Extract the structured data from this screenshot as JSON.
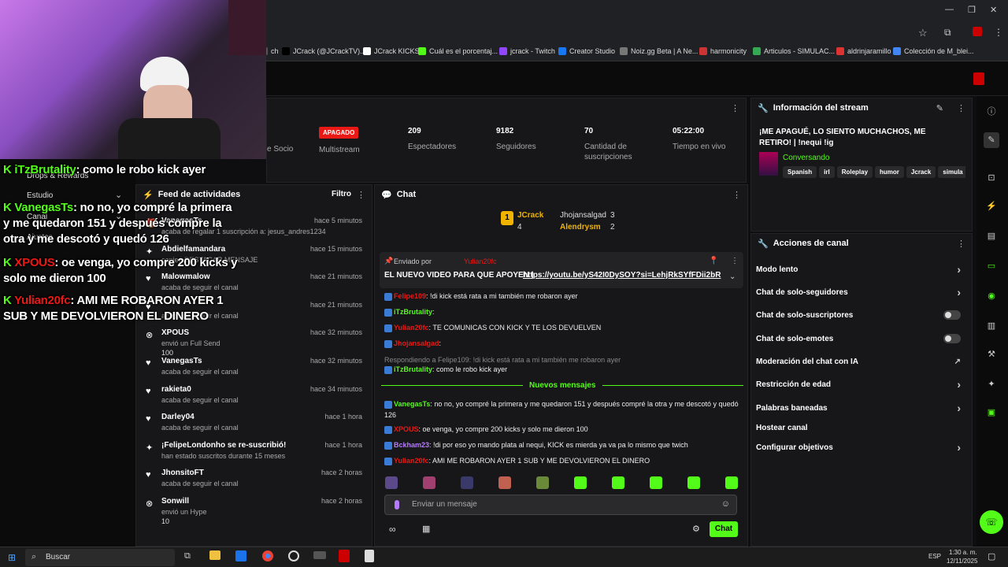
{
  "bookmarks": [
    {
      "label": "ch",
      "color": "#555"
    },
    {
      "label": "JCrack (@JCrackTV)...",
      "color": "#000"
    },
    {
      "label": "JCrack KICKS",
      "color": "#fff"
    },
    {
      "label": "Cuál es el porcentaj...",
      "color": "#53fc18"
    },
    {
      "label": "jcrack - Twitch",
      "color": "#9146ff"
    },
    {
      "label": "Creator Studio",
      "color": "#1877f2"
    },
    {
      "label": "Noiz.gg Beta | A Ne...",
      "color": "#777"
    },
    {
      "label": "harmonicity",
      "color": "#c33"
    },
    {
      "label": "Articulos - SIMULAC...",
      "color": "#34a853"
    },
    {
      "label": "aldrinjaramillo",
      "color": "#d33"
    },
    {
      "label": "Colección de M_blei...",
      "color": "#4285f4"
    }
  ],
  "stats": {
    "socio_label": "e Socio",
    "multistream_badge": "APAGADO",
    "multistream_label": "Multistream",
    "viewers_value": "209",
    "viewers_label": "Espectadores",
    "followers_value": "9182",
    "followers_label": "Seguidores",
    "subs_value": "70",
    "subs_label": "Cantidad de suscripciones",
    "live_value": "05:22:00",
    "live_label": "Tiempo en vivo"
  },
  "stream_info": {
    "header": "Información del stream",
    "title": "¡ME APAGUÉ, LO SIENTO MUCHACHOS, ME RETIRO! | !nequi !ig",
    "category": "Conversando",
    "tags": [
      "Spanish",
      "irl",
      "Roleplay",
      "humor",
      "Jcrack",
      "simula"
    ]
  },
  "left_nav": {
    "drops": "Drops & Rewards",
    "studio": "Estudio",
    "canal": "Canal",
    "ajustes": "Ajustes"
  },
  "feed": {
    "header": "Feed de actividades",
    "filter": "Filtro",
    "items": [
      {
        "name": "VanegasTs",
        "sub": "acaba de regalar 1 suscripción a: jesus_andres1234",
        "time": "hace 5 minutos",
        "icon": "gift-icon"
      },
      {
        "name": "Abdielfamandara",
        "sub": "canjeó DESTACAR MENSAJE",
        "time": "hace 15 minutos",
        "icon": "star-icon"
      },
      {
        "name": "Malowmalow",
        "sub": "acaba de seguir el canal",
        "time": "hace 21 minutos",
        "icon": "heart-icon"
      },
      {
        "name": "",
        "sub": "acaba de seguir el canal",
        "time": "hace 21 minutos",
        "icon": "heart-icon"
      },
      {
        "name": "XPOUS",
        "sub": "envió un Full Send",
        "extra": "100",
        "time": "hace 32 minutos",
        "icon": "kick-icon"
      },
      {
        "name": "VanegasTs",
        "sub": "acaba de seguir el canal",
        "time": "hace 32 minutos",
        "icon": "heart-icon"
      },
      {
        "name": "rakieta0",
        "sub": "acaba de seguir el canal",
        "time": "hace 34 minutos",
        "icon": "heart-icon"
      },
      {
        "name": "Darley04",
        "sub": "acaba de seguir el canal",
        "time": "hace 1 hora",
        "icon": "heart-icon"
      },
      {
        "name": "¡FelipeLondonho se re-suscribió!",
        "sub": "han estado suscritos durante 15 meses",
        "time": "hace 1 hora",
        "icon": "star-icon"
      },
      {
        "name": "JhonsitoFT",
        "sub": "acaba de seguir el canal",
        "time": "hace 2 horas",
        "icon": "heart-icon"
      },
      {
        "name": "Sonwill",
        "sub": "envió un Hype",
        "extra": "10",
        "time": "hace 2 horas",
        "icon": "kick-icon"
      }
    ]
  },
  "chat": {
    "header": "Chat",
    "top_users": [
      {
        "name": "JCrack",
        "count": "4"
      },
      {
        "name": "Jhojansalgad",
        "count": "3"
      },
      {
        "name": "Alendrysm",
        "count": "2"
      }
    ],
    "pinned_by_label": "Enviado por",
    "pinned_by_user": "Yulian20fc",
    "pinned_text": "EL NUEVO VIDEO PARA QUE APOYEN |",
    "pinned_link": "https://youtu.be/yS42I0DySOY?si=LehjRkSYfFDii2bR",
    "messages": [
      {
        "user": "Felipe109",
        "color": "#e91916",
        "text": "!di kick está rata a mi también me robaron ayer"
      },
      {
        "user": "iTzBrutality",
        "color": "#53fc18",
        "text": ""
      },
      {
        "user": "Yulian20fc",
        "color": "#e91916",
        "text": "TE COMUNICAS CON KICK Y TE LOS DEVUELVEN"
      },
      {
        "user": "Jhojansalgad",
        "color": "#e91916",
        "text": ""
      },
      {
        "reply": "Respondiendo a Felipe109: !di kick está rata a mi también me robaron ayer"
      },
      {
        "user": "iTzBrutality",
        "color": "#53fc18",
        "text": "como le robo kick ayer"
      }
    ],
    "new_messages_label": "Nuevos mensajes",
    "new_messages": [
      {
        "user": "VanegasTs",
        "color": "#53fc18",
        "text": "no no, yo compré la primera y me quedaron 151 y después compré la otra y me descotó y quedó 126"
      },
      {
        "user": "XPOUS",
        "color": "#e91916",
        "text": "oe venga, yo compre 200 kicks y solo me dieron 100"
      },
      {
        "user": "Bckham23",
        "color": "#b57bff",
        "text": "!di por eso yo mando plata al nequi, KICK es mierda ya va pa lo mismo que twich"
      },
      {
        "user": "Yulian20fc",
        "color": "#e91916",
        "text": "AMI ME ROBARON AYER 1 SUB Y ME DEVOLVIERON EL DINERO"
      }
    ],
    "input_placeholder": "Enviar un mensaje",
    "send_label": "Chat"
  },
  "actions": {
    "header": "Acciones de canal",
    "items": [
      "Modo lento",
      "Chat de solo-seguidores",
      "Chat de solo-suscriptores",
      "Chat de solo-emotes",
      "Moderación del chat con IA",
      "Restricción de edad",
      "Palabras baneadas",
      "Hostear canal",
      "Configurar objetivos"
    ]
  },
  "overlay": [
    {
      "user": "iTzBrutality",
      "color": "#53fc18",
      "text": ": como le robo kick ayer"
    },
    {
      "user": "VanegasTs",
      "color": "#53fc18",
      "text": ": no no, yo compré la primera y me quedaron 151 y después compre la otra y me descotó y quedó 126"
    },
    {
      "user": "XPOUS",
      "color": "#e91916",
      "text": ": oe venga, yo compre 200 kicks y solo me dieron 100"
    },
    {
      "user": "Yulian20fc",
      "color": "#e91916",
      "text": ": AMI ME ROBARON AYER 1 SUB Y ME DEVOLVIERON EL DINERO"
    }
  ],
  "taskbar": {
    "search": "Buscar",
    "lang": "ESP",
    "time": "1:30 a. m.",
    "date": "12/11/2025"
  }
}
